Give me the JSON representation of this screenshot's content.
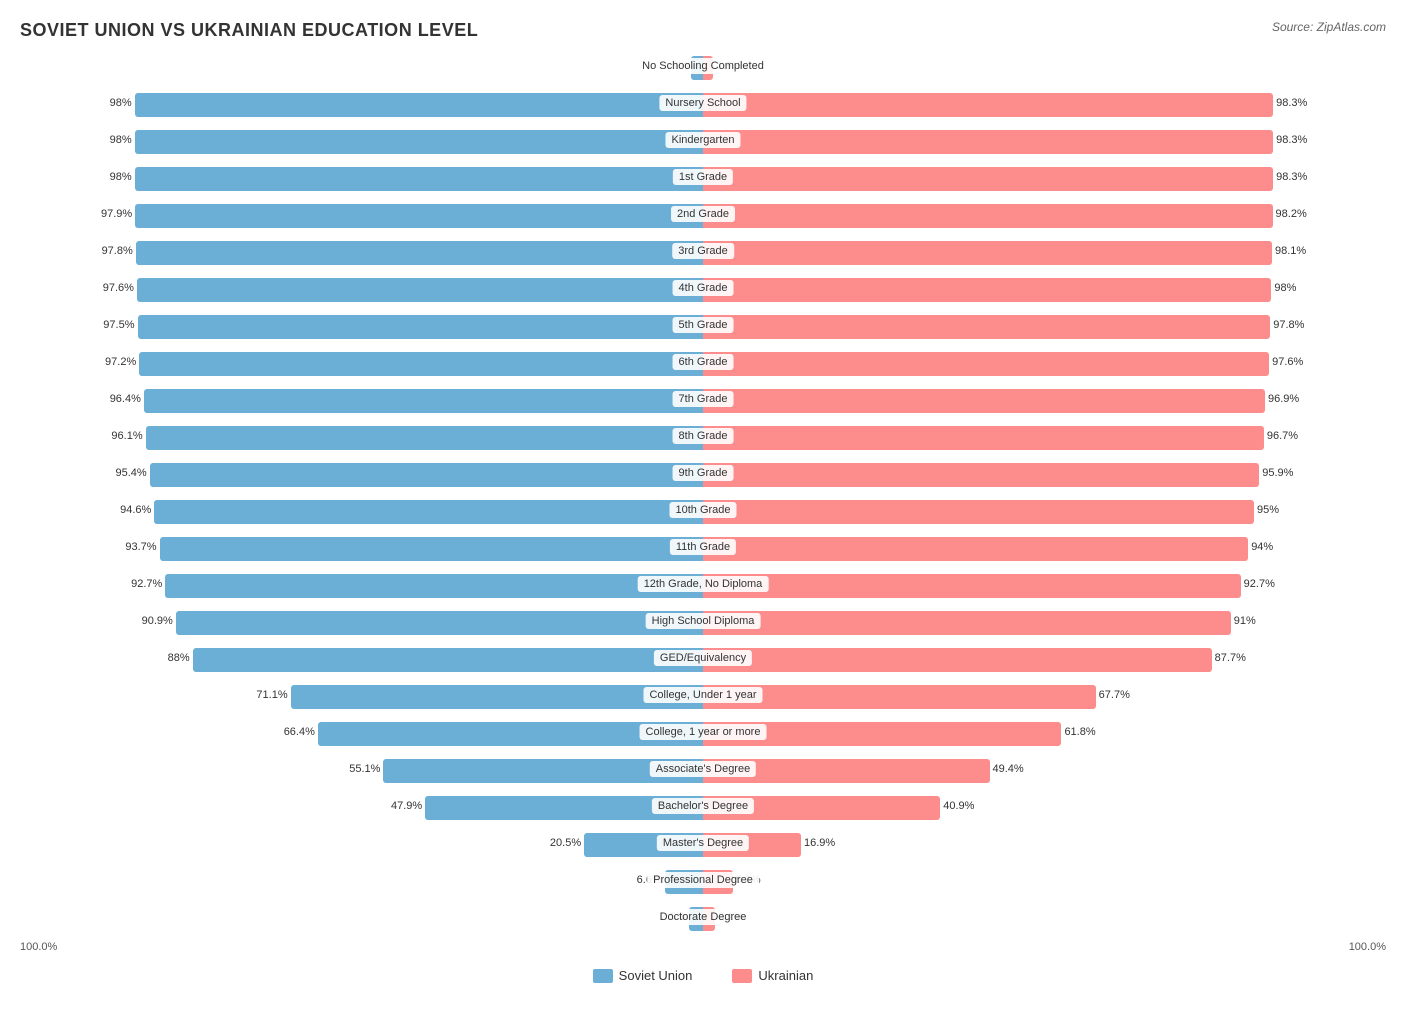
{
  "title": "SOVIET UNION VS UKRAINIAN EDUCATION LEVEL",
  "source": "Source: ZipAtlas.com",
  "colors": {
    "soviet": "#6baed6",
    "ukrainian": "#fd8d8d"
  },
  "legend": {
    "soviet_label": "Soviet Union",
    "ukrainian_label": "Ukrainian"
  },
  "bottom_left": "100.0%",
  "bottom_right": "100.0%",
  "rows": [
    {
      "label": "No Schooling Completed",
      "left_val": 2.0,
      "right_val": 1.8,
      "left_pct": 2.0,
      "right_pct": 1.8
    },
    {
      "label": "Nursery School",
      "left_val": 98.0,
      "right_val": 98.3,
      "left_pct": 98.0,
      "right_pct": 98.3
    },
    {
      "label": "Kindergarten",
      "left_val": 98.0,
      "right_val": 98.3,
      "left_pct": 98.0,
      "right_pct": 98.3
    },
    {
      "label": "1st Grade",
      "left_val": 98.0,
      "right_val": 98.3,
      "left_pct": 98.0,
      "right_pct": 98.3
    },
    {
      "label": "2nd Grade",
      "left_val": 97.9,
      "right_val": 98.2,
      "left_pct": 97.9,
      "right_pct": 98.2
    },
    {
      "label": "3rd Grade",
      "left_val": 97.8,
      "right_val": 98.1,
      "left_pct": 97.8,
      "right_pct": 98.1
    },
    {
      "label": "4th Grade",
      "left_val": 97.6,
      "right_val": 98.0,
      "left_pct": 97.6,
      "right_pct": 98.0
    },
    {
      "label": "5th Grade",
      "left_val": 97.5,
      "right_val": 97.8,
      "left_pct": 97.5,
      "right_pct": 97.8
    },
    {
      "label": "6th Grade",
      "left_val": 97.2,
      "right_val": 97.6,
      "left_pct": 97.2,
      "right_pct": 97.6
    },
    {
      "label": "7th Grade",
      "left_val": 96.4,
      "right_val": 96.9,
      "left_pct": 96.4,
      "right_pct": 96.9
    },
    {
      "label": "8th Grade",
      "left_val": 96.1,
      "right_val": 96.7,
      "left_pct": 96.1,
      "right_pct": 96.7
    },
    {
      "label": "9th Grade",
      "left_val": 95.4,
      "right_val": 95.9,
      "left_pct": 95.4,
      "right_pct": 95.9
    },
    {
      "label": "10th Grade",
      "left_val": 94.6,
      "right_val": 95.0,
      "left_pct": 94.6,
      "right_pct": 95.0
    },
    {
      "label": "11th Grade",
      "left_val": 93.7,
      "right_val": 94.0,
      "left_pct": 93.7,
      "right_pct": 94.0
    },
    {
      "label": "12th Grade, No Diploma",
      "left_val": 92.7,
      "right_val": 92.7,
      "left_pct": 92.7,
      "right_pct": 92.7
    },
    {
      "label": "High School Diploma",
      "left_val": 90.9,
      "right_val": 91.0,
      "left_pct": 90.9,
      "right_pct": 91.0
    },
    {
      "label": "GED/Equivalency",
      "left_val": 88.0,
      "right_val": 87.7,
      "left_pct": 88.0,
      "right_pct": 87.7
    },
    {
      "label": "College, Under 1 year",
      "left_val": 71.1,
      "right_val": 67.7,
      "left_pct": 71.1,
      "right_pct": 67.7
    },
    {
      "label": "College, 1 year or more",
      "left_val": 66.4,
      "right_val": 61.8,
      "left_pct": 66.4,
      "right_pct": 61.8
    },
    {
      "label": "Associate's Degree",
      "left_val": 55.1,
      "right_val": 49.4,
      "left_pct": 55.1,
      "right_pct": 49.4
    },
    {
      "label": "Bachelor's Degree",
      "left_val": 47.9,
      "right_val": 40.9,
      "left_pct": 47.9,
      "right_pct": 40.9
    },
    {
      "label": "Master's Degree",
      "left_val": 20.5,
      "right_val": 16.9,
      "left_pct": 20.5,
      "right_pct": 16.9
    },
    {
      "label": "Professional Degree",
      "left_val": 6.6,
      "right_val": 5.1,
      "left_pct": 6.6,
      "right_pct": 5.1
    },
    {
      "label": "Doctorate Degree",
      "left_val": 2.5,
      "right_val": 2.1,
      "left_pct": 2.5,
      "right_pct": 2.1
    }
  ]
}
